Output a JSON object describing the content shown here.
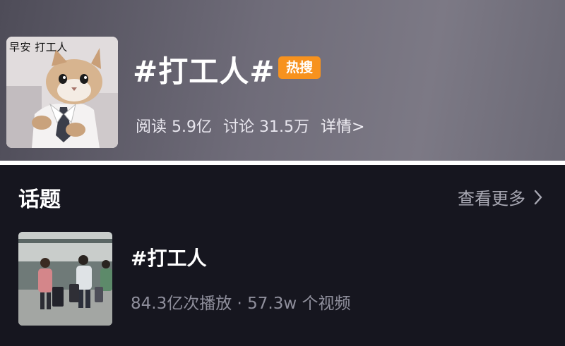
{
  "header": {
    "cover_caption": "早安 打工人",
    "topic_title": "#打工人#",
    "hot_badge": "热搜",
    "stats": {
      "reads": "阅读 5.9亿",
      "discussions": "讨论 31.5万",
      "details_link": "详情>"
    }
  },
  "section": {
    "title": "话题",
    "see_more": "查看更多"
  },
  "topic_item": {
    "title": "#打工人",
    "meta": "84.3亿次播放 · 57.3w 个视频"
  },
  "colors": {
    "hot_badge": "#f7921e",
    "bottom_background": "#16161f"
  }
}
